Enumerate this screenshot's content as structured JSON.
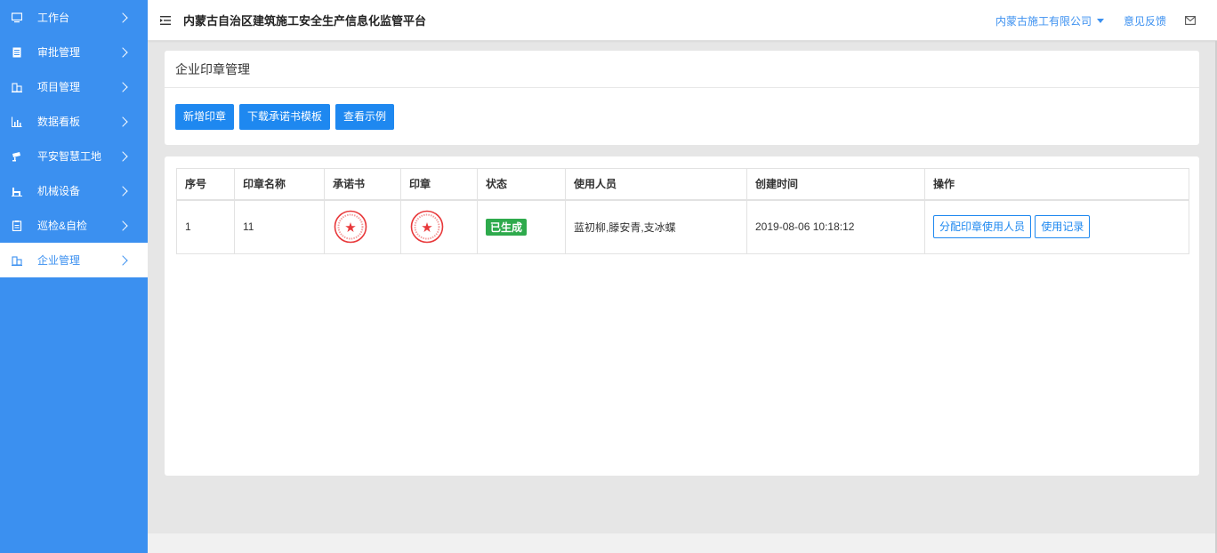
{
  "sidebar": {
    "items": [
      {
        "label": "工作台",
        "icon": "monitor-icon"
      },
      {
        "label": "审批管理",
        "icon": "document-icon"
      },
      {
        "label": "项目管理",
        "icon": "building-icon"
      },
      {
        "label": "数据看板",
        "icon": "chart-icon"
      },
      {
        "label": "平安智慧工地",
        "icon": "camera-icon"
      },
      {
        "label": "机械设备",
        "icon": "machine-icon"
      },
      {
        "label": "巡检&自检",
        "icon": "clipboard-icon"
      },
      {
        "label": "企业管理",
        "icon": "building-icon"
      }
    ],
    "active_index": 7
  },
  "header": {
    "title": "内蒙古自治区建筑施工安全生产信息化监管平台",
    "company": "内蒙古施工有限公司",
    "feedback": "意见反馈"
  },
  "page": {
    "title": "企业印章管理",
    "buttons": {
      "add": "新增印章",
      "download": "下载承诺书模板",
      "example": "查看示例"
    }
  },
  "table": {
    "headers": {
      "index": "序号",
      "name": "印章名称",
      "letter": "承诺书",
      "seal": "印章",
      "status": "状态",
      "users": "使用人员",
      "created": "创建时间",
      "actions": "操作"
    },
    "rows": [
      {
        "index": "1",
        "name": "11",
        "status": "已生成",
        "users": "蓝初柳,滕安青,支冰蝶",
        "created": "2019-08-06 10:18:12",
        "action_assign": "分配印章使用人员",
        "action_log": "使用记录"
      }
    ]
  },
  "colors": {
    "sidebar_bg": "#3b90f0",
    "primary": "#1e88f0",
    "status_green": "#2eaa4c",
    "seal_red": "#e8393b"
  }
}
